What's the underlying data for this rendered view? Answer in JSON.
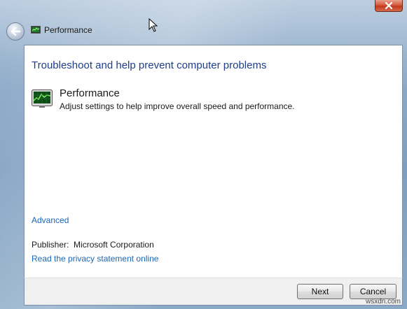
{
  "window": {
    "title": "Performance",
    "title_icon": "performance-monitor-icon",
    "close_icon": "close-icon",
    "back_icon": "back-arrow-icon"
  },
  "main": {
    "heading": "Troubleshoot and help prevent computer problems",
    "item": {
      "icon": "performance-monitor-icon",
      "title": "Performance",
      "description": "Adjust settings to help improve overall speed and performance."
    },
    "advanced_link": "Advanced",
    "publisher_label": "Publisher:",
    "publisher_value": "Microsoft Corporation",
    "privacy_link": "Read the privacy statement online"
  },
  "footer": {
    "next_label": "Next",
    "cancel_label": "Cancel"
  },
  "watermark": "wsxdn.com",
  "colors": {
    "link": "#1a66b8",
    "heading": "#1e3e8c",
    "close_button": "#c2391d"
  }
}
